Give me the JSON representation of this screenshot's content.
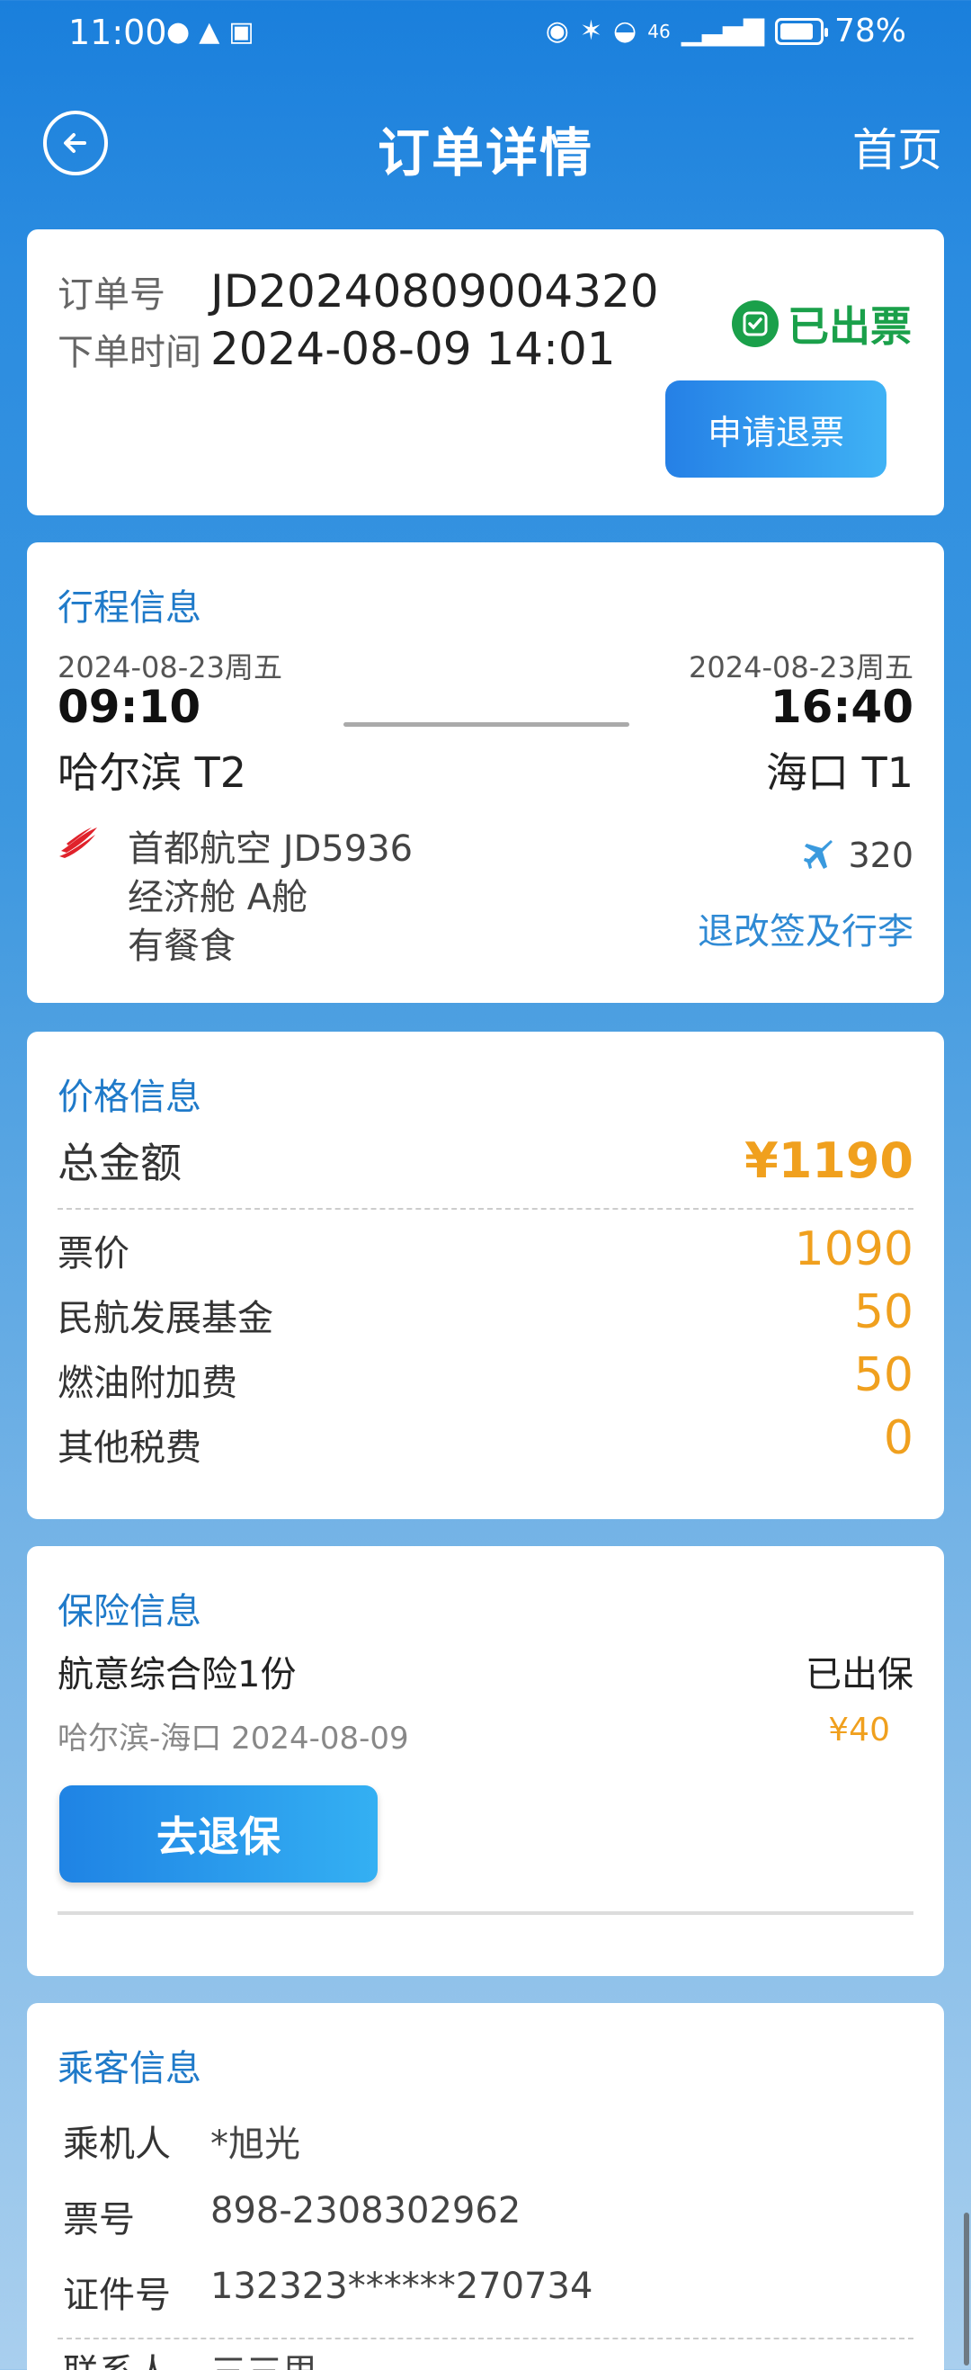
{
  "status_bar": {
    "time": "11:00",
    "network": "46",
    "battery": "78%"
  },
  "nav": {
    "title": "订单详情",
    "home": "首页"
  },
  "order": {
    "number_label": "订单号",
    "number": "JD20240809004320",
    "time_label": "下单时间",
    "time": "2024-08-09 14:01",
    "status": "已出票",
    "refund_button": "申请退票"
  },
  "itinerary": {
    "title": "行程信息",
    "dep_date": "2024-08-23周五",
    "arr_date": "2024-08-23周五",
    "dep_time": "09:10",
    "arr_time": "16:40",
    "dep_airport": "哈尔滨 T2",
    "arr_airport": "海口 T1",
    "airline_flight": "首都航空 JD5936",
    "cabin": "经济舱 A舱",
    "meal": "有餐食",
    "aircraft": "320",
    "rules_link": "退改签及行李"
  },
  "price": {
    "title": "价格信息",
    "total_label": "总金额",
    "total": "¥1190",
    "items": [
      {
        "label": "票价",
        "value": "1090"
      },
      {
        "label": "民航发展基金",
        "value": "50"
      },
      {
        "label": "燃油附加费",
        "value": "50"
      },
      {
        "label": "其他税费",
        "value": "0"
      }
    ]
  },
  "insurance": {
    "title": "保险信息",
    "name": "航意综合险1份",
    "status": "已出保",
    "route": "哈尔滨-海口 2024-08-09",
    "price": "¥40",
    "button": "去退保"
  },
  "passenger": {
    "title": "乘客信息",
    "rows": [
      {
        "label": "乘机人",
        "value": "*旭光"
      },
      {
        "label": "票号",
        "value": "898-2308302962"
      },
      {
        "label": "证件号",
        "value": "132323******270734"
      },
      {
        "label": "联系人",
        "value": "三三思"
      }
    ]
  },
  "colors": {
    "accent": "#1f7ac9",
    "price": "#f0a01e",
    "success": "#1aa04a"
  }
}
